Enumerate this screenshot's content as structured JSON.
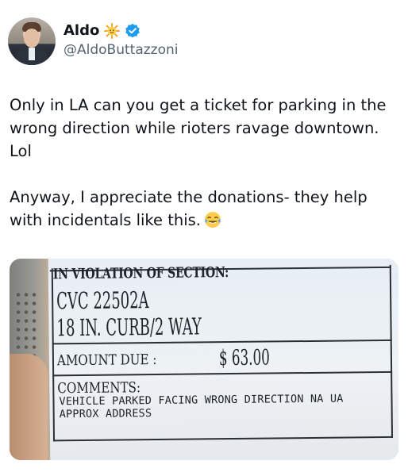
{
  "author": {
    "name": "Aldo",
    "handle": "@AldoButtazzoni",
    "badges": [
      "sun-emoji-icon",
      "verified-badge-icon"
    ],
    "verified_color": "#1d9bf0"
  },
  "tweet": {
    "text": "Only in LA can you get a ticket for parking in the wrong direction while rioters ravage downtown. Lol\n\nAnyway, I appreciate the donations- they help with incidentals like this.",
    "emoji": "face-with-tears-of-joy-icon"
  },
  "ticket": {
    "section_header": "IN VIOLATION OF SECTION:",
    "code": "CVC 22502A",
    "description": "18 IN. CURB/2 WAY",
    "amount_label": "AMOUNT DUE :",
    "amount": "$ 63.00",
    "comments_label": "COMMENTS:",
    "comments_line1": "VEHICLE PARKED FACING WRONG DIRECTION NA UA",
    "comments_line2": "APPROX ADDRESS"
  }
}
